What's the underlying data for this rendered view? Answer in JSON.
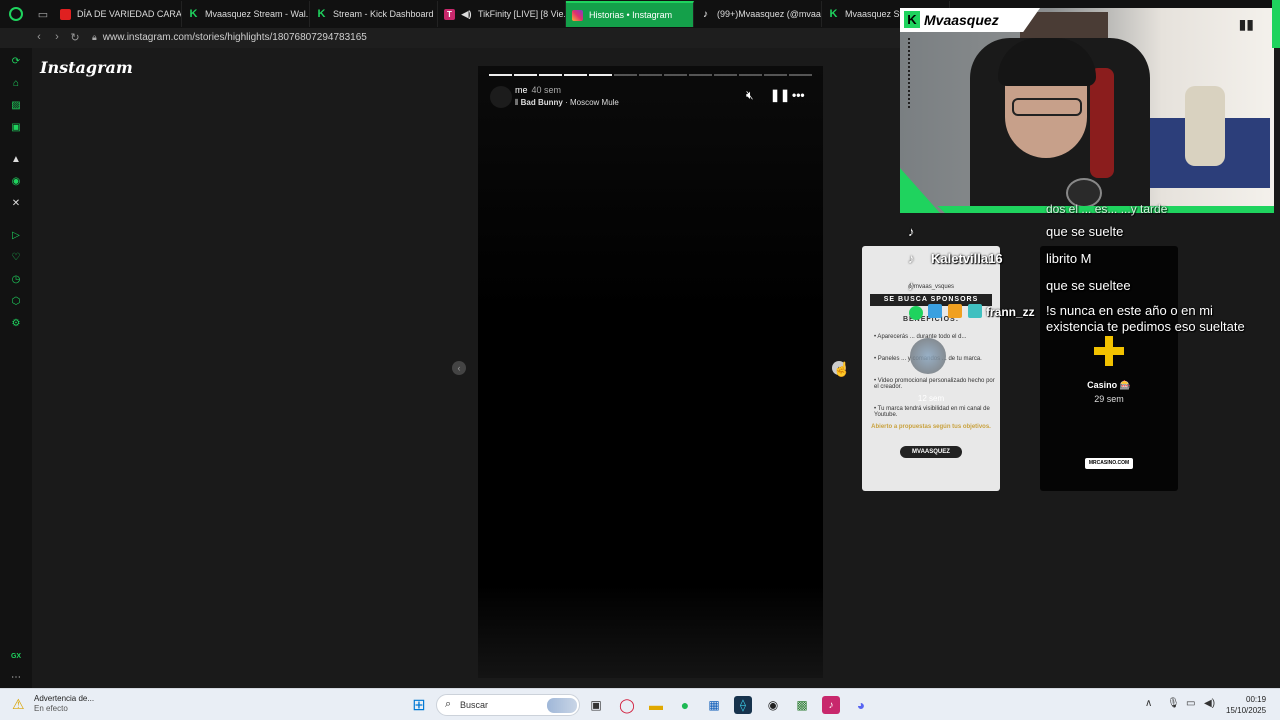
{
  "tabs": [
    {
      "label": "DÍA DE VARIEDAD CARAJ...",
      "icon": "youtube-icon"
    },
    {
      "label": "Mvaasquez Stream - Wal...",
      "icon": "kick-icon"
    },
    {
      "label": "Stream - Kick Dashboard",
      "icon": "kick-icon"
    },
    {
      "label": "TikFinity [LIVE] [8 Vie...",
      "icon": "tikfinity-icon"
    },
    {
      "label": "Historias • Instagram",
      "icon": "instagram-icon",
      "active": true
    },
    {
      "label": "(99+)Mvaasquez (@mvaas...",
      "icon": "tiktok-icon"
    },
    {
      "label": "Mvaasquez Str...",
      "icon": "kick-icon"
    }
  ],
  "address": {
    "url": "www.instagram.com/stories/highlights/18076807294783165"
  },
  "page": {
    "logo": "Instagram"
  },
  "story": {
    "username": "me",
    "time": "40 sem",
    "music_artist": "Bad Bunny",
    "music_song": "Moscow Mule",
    "progress_total": 13,
    "progress_done": 5
  },
  "cards": {
    "sponsor": {
      "handle": "@mvaas_vsques",
      "headline": "SE BUSCA SPONSORS",
      "benefits": "BENEFICIOS:",
      "lines": [
        "• Aparecerás ... durante todo el d...",
        "• Paneles ... y comandos ... de tu marca.",
        "• Video promocional personalizado hecho por el creador.",
        "• Tu marca tendrá visibilidad en mi canal de Youtube."
      ],
      "open_text": "Abierto a propuestas según tus objetivos.",
      "brand": "MVAASQUEZ",
      "time": "12 sem",
      "mid_text": "SE..."
    },
    "casino": {
      "name": "Casino 🎰",
      "time": "29 sem",
      "badge": "MRCASINO.COM"
    }
  },
  "stream": {
    "streamer_name": "Mvaasquez"
  },
  "chat": {
    "partial": "dos el ... es... ...y tarde",
    "user1": "Kaletvilla16",
    "user2": "frann_zz",
    "messages": [
      "que se suelte",
      "librito M",
      "que se sueltee",
      "!s nunca en este año o en mi",
      "existencia te pedimos eso sueltate"
    ]
  },
  "taskbar": {
    "notif_title": "Advertencia de...",
    "notif_sub": "En efecto",
    "search_placeholder": "Buscar",
    "time": "00:19",
    "date": "15/10/2025"
  },
  "sidebar": {
    "gx_label": "GX"
  },
  "colors": {
    "accent": "#1fd35e",
    "kick_green": "#53fc18",
    "story_bg": "#000000"
  }
}
